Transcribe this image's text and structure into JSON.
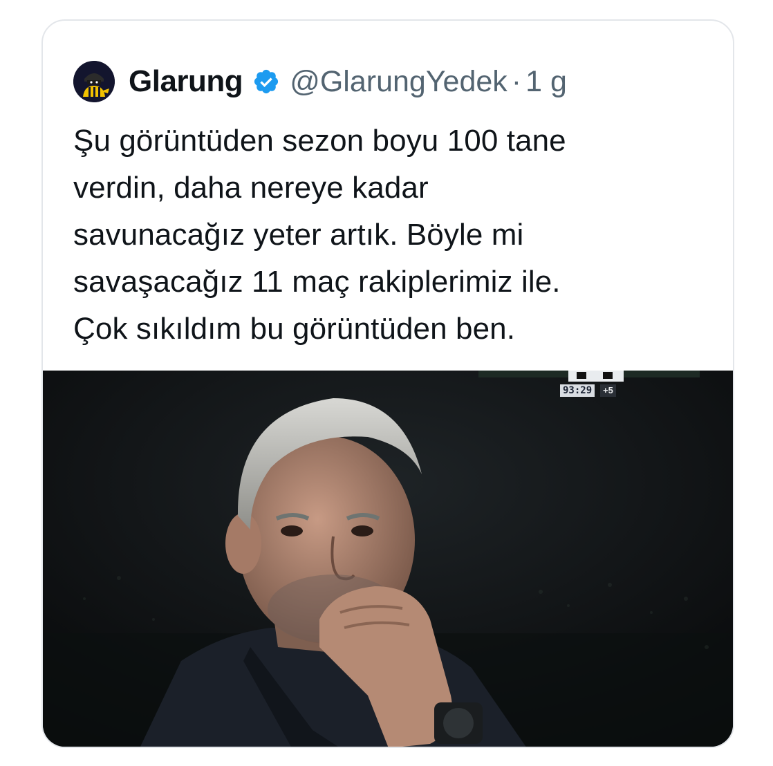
{
  "tweet": {
    "display_name": "Glarung",
    "handle": "@GlarungYedek",
    "separator": "·",
    "time": "1 g",
    "verified": true,
    "text": "Şu görüntüden sezon boyu 100 tane\nverdin, daha nereye kadar\nsavunacağız yeter artık. Böyle mi\nsavaşacağız 11 maç rakiplerimiz ile.\nÇok sıkıldım bu görüntüden ben."
  },
  "media": {
    "match_clock": "93:29",
    "added_time": "+5"
  },
  "colors": {
    "text_primary": "#0f1419",
    "text_secondary": "#536471",
    "verified_blue": "#1d9bf0",
    "card_border": "#e3e6ea",
    "avatar_bg": "#13152e",
    "avatar_accent": "#f2c200"
  },
  "icons": {
    "verified": "verified-badge-icon",
    "avatar": "masked-fan-avatar"
  }
}
